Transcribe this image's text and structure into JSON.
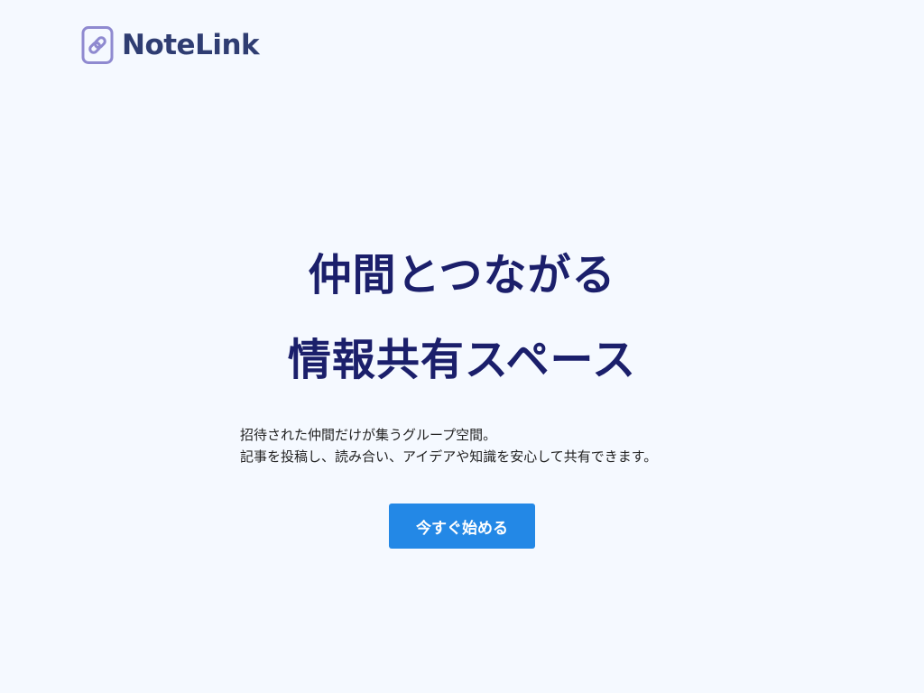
{
  "brand": {
    "name": "NoteLink",
    "color": "#2f3d72",
    "icon": "chain-link-icon",
    "icon_color": "#8f8ad0"
  },
  "hero": {
    "line1": "仲間とつながる",
    "line2": "情報共有スペース",
    "color": "#1b1f6b"
  },
  "description": {
    "line1": "招待された仲間だけが集うグループ空間。",
    "line2": "記事を投稿し、読み合い、アイデアや知識を安心して共有できます。"
  },
  "cta": {
    "label": "今すぐ始める",
    "color": "#2388e6"
  },
  "background": "#f5f9ff"
}
